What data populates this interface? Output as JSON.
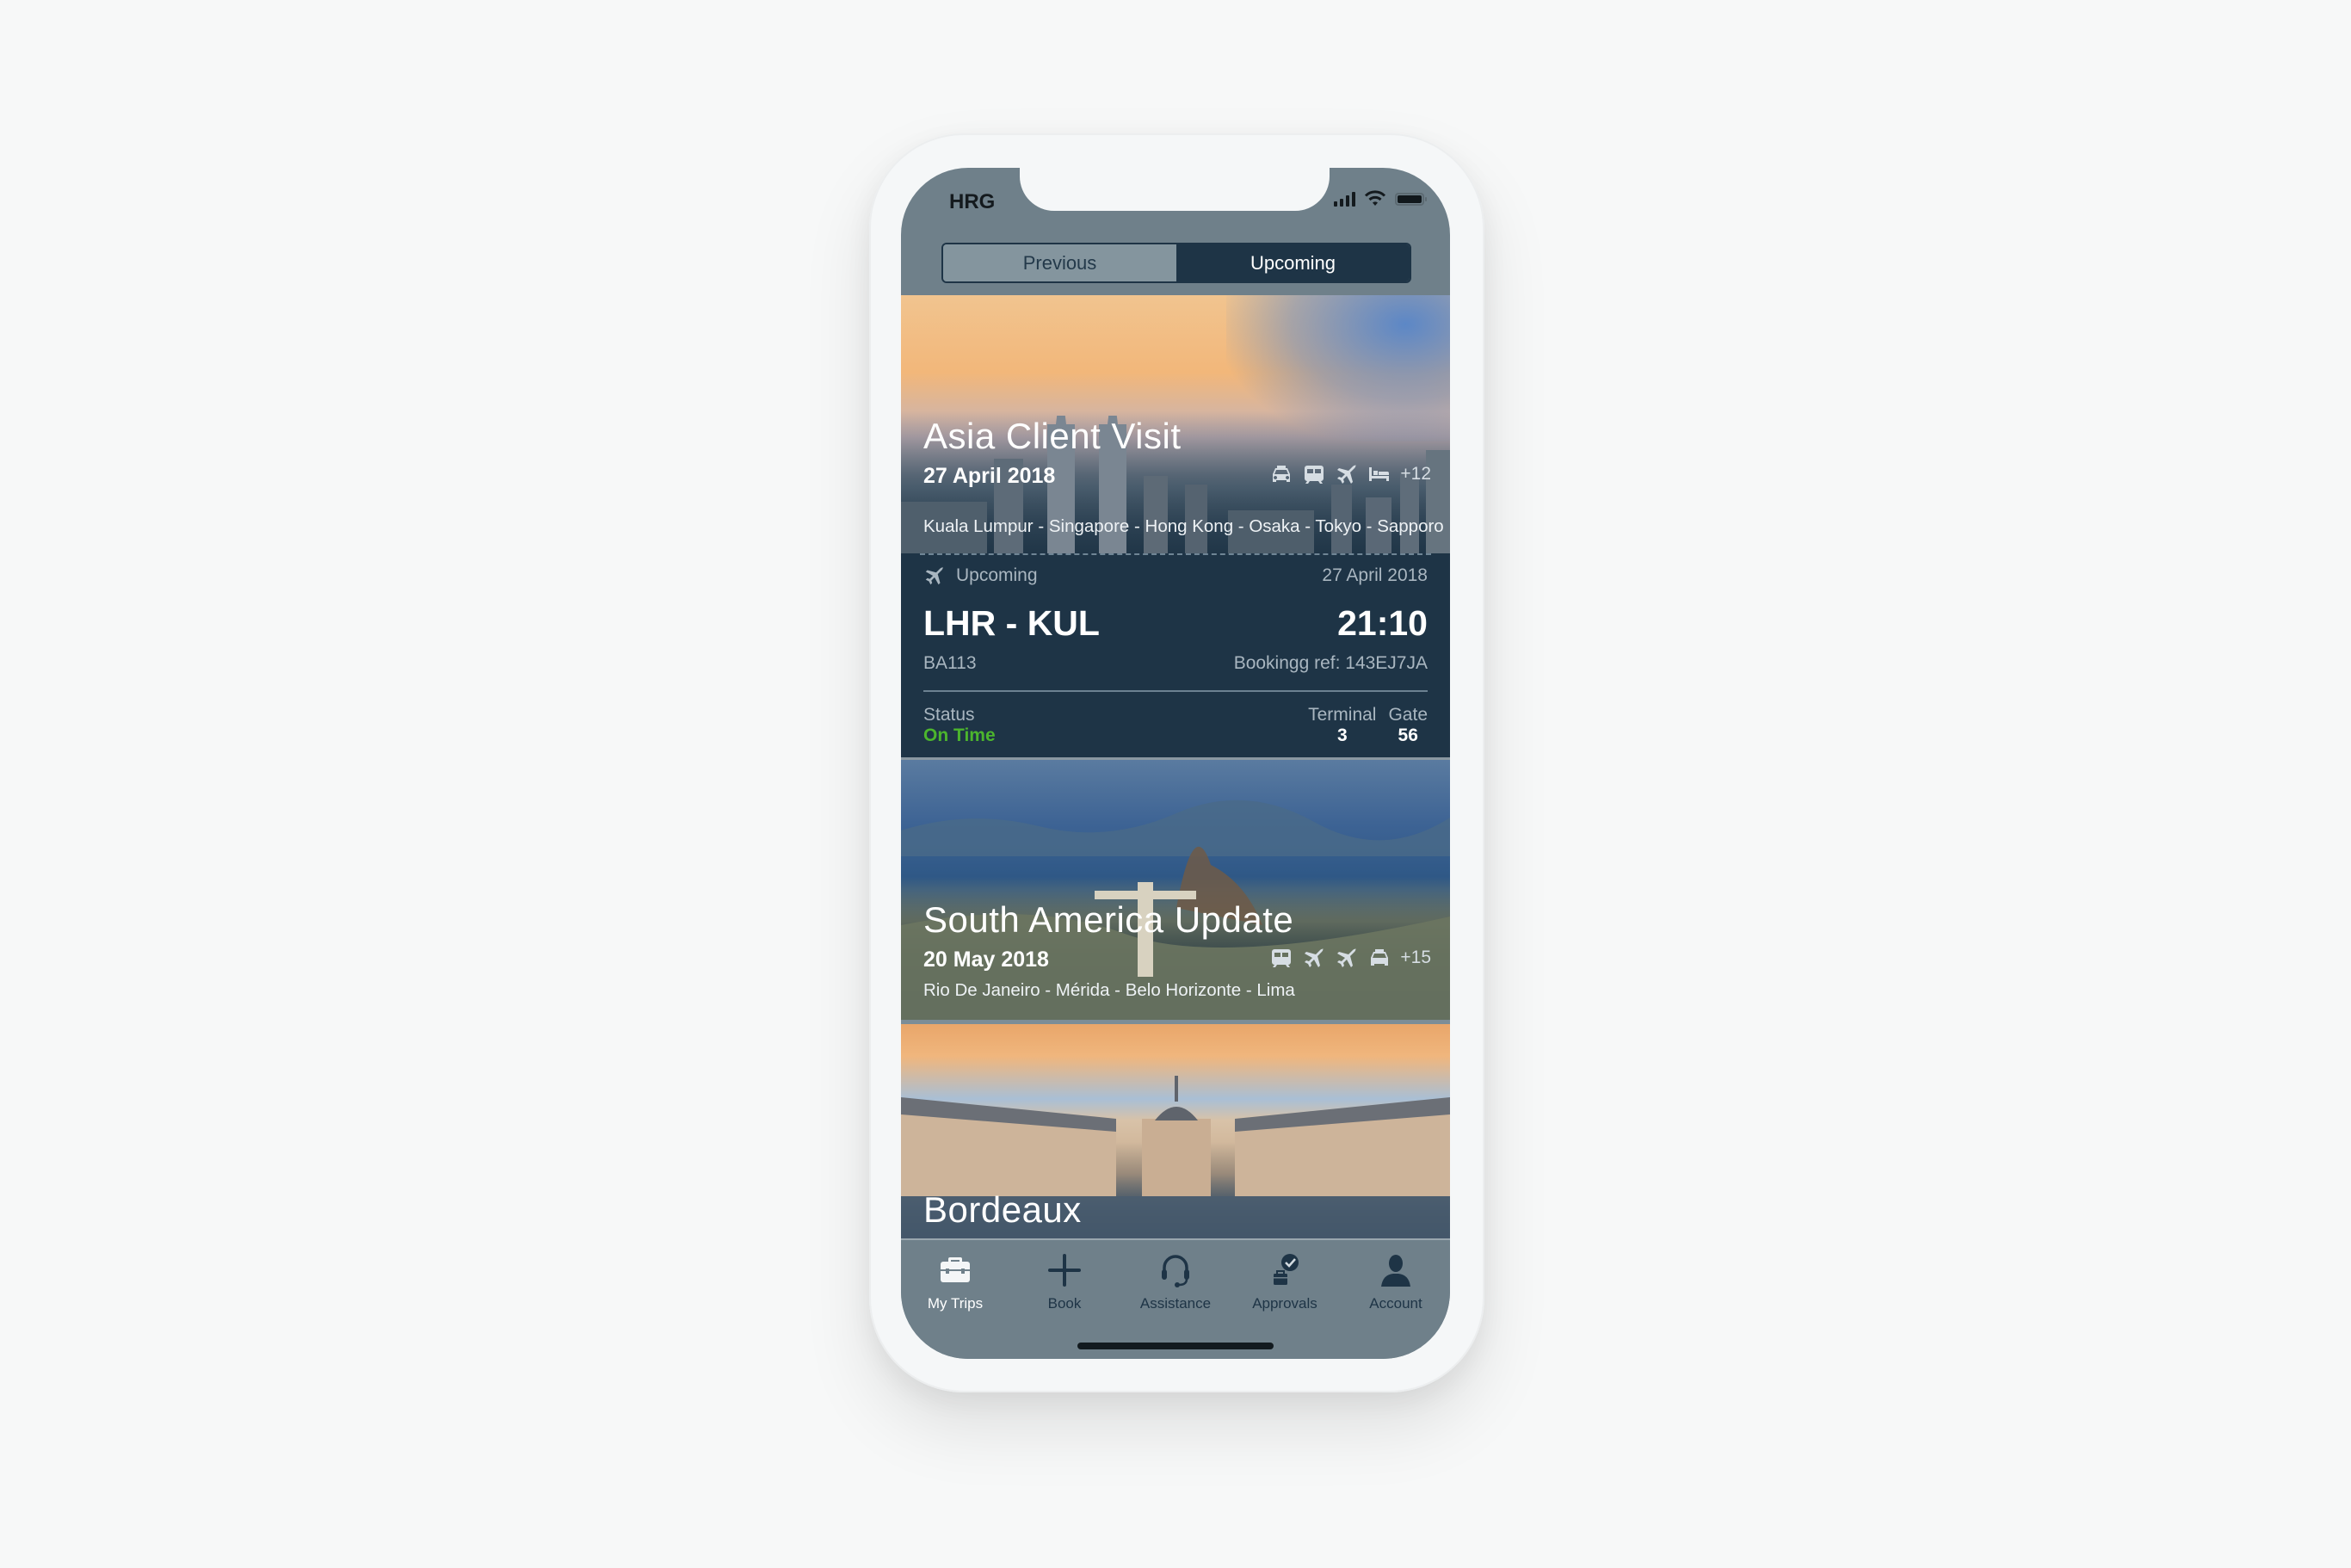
{
  "status_bar": {
    "carrier": "HRG",
    "icons": [
      "signal-icon",
      "wifi-icon",
      "battery-icon"
    ]
  },
  "segmented_control": {
    "options": [
      "Previous",
      "Upcoming"
    ],
    "selected": "Upcoming"
  },
  "trips": [
    {
      "title": "Asia Client Visit",
      "date": "27 April 2018",
      "cities": "Kuala Lumpur - Singapore - Hong Kong - Osaka - Tokyo - Sapporo",
      "icons": [
        "car-icon",
        "train-icon",
        "plane-icon",
        "hotel-icon"
      ],
      "more_count": "+12",
      "next_segment": {
        "status_label": "Upcoming",
        "date": "27 April 2018",
        "route": "LHR - KUL",
        "time": "21:10",
        "flight_number": "BA113",
        "booking_ref": "Bookingg ref: 143EJ7JA",
        "status_heading": "Status",
        "status_value": "On Time",
        "terminal_heading": "Terminal",
        "terminal_value": "3",
        "gate_heading": "Gate",
        "gate_value": "56"
      }
    },
    {
      "title": "South America Update",
      "date": "20 May 2018",
      "cities": "Rio De Janeiro - Mérida - Belo Horizonte - Lima",
      "icons": [
        "train-icon",
        "plane-icon",
        "plane-icon",
        "car-icon"
      ],
      "more_count": "+15"
    },
    {
      "title": "Bordeaux"
    }
  ],
  "tab_bar": {
    "items": [
      {
        "label": "My Trips",
        "icon": "briefcase-icon",
        "active": true
      },
      {
        "label": "Book",
        "icon": "plus-icon",
        "active": false
      },
      {
        "label": "Assistance",
        "icon": "headset-icon",
        "active": false
      },
      {
        "label": "Approvals",
        "icon": "approvals-icon",
        "active": false
      },
      {
        "label": "Account",
        "icon": "person-icon",
        "active": false
      }
    ]
  },
  "colors": {
    "navy": "#1e3446",
    "slate": "#6f808a",
    "on_time_green": "#4cb52d"
  }
}
